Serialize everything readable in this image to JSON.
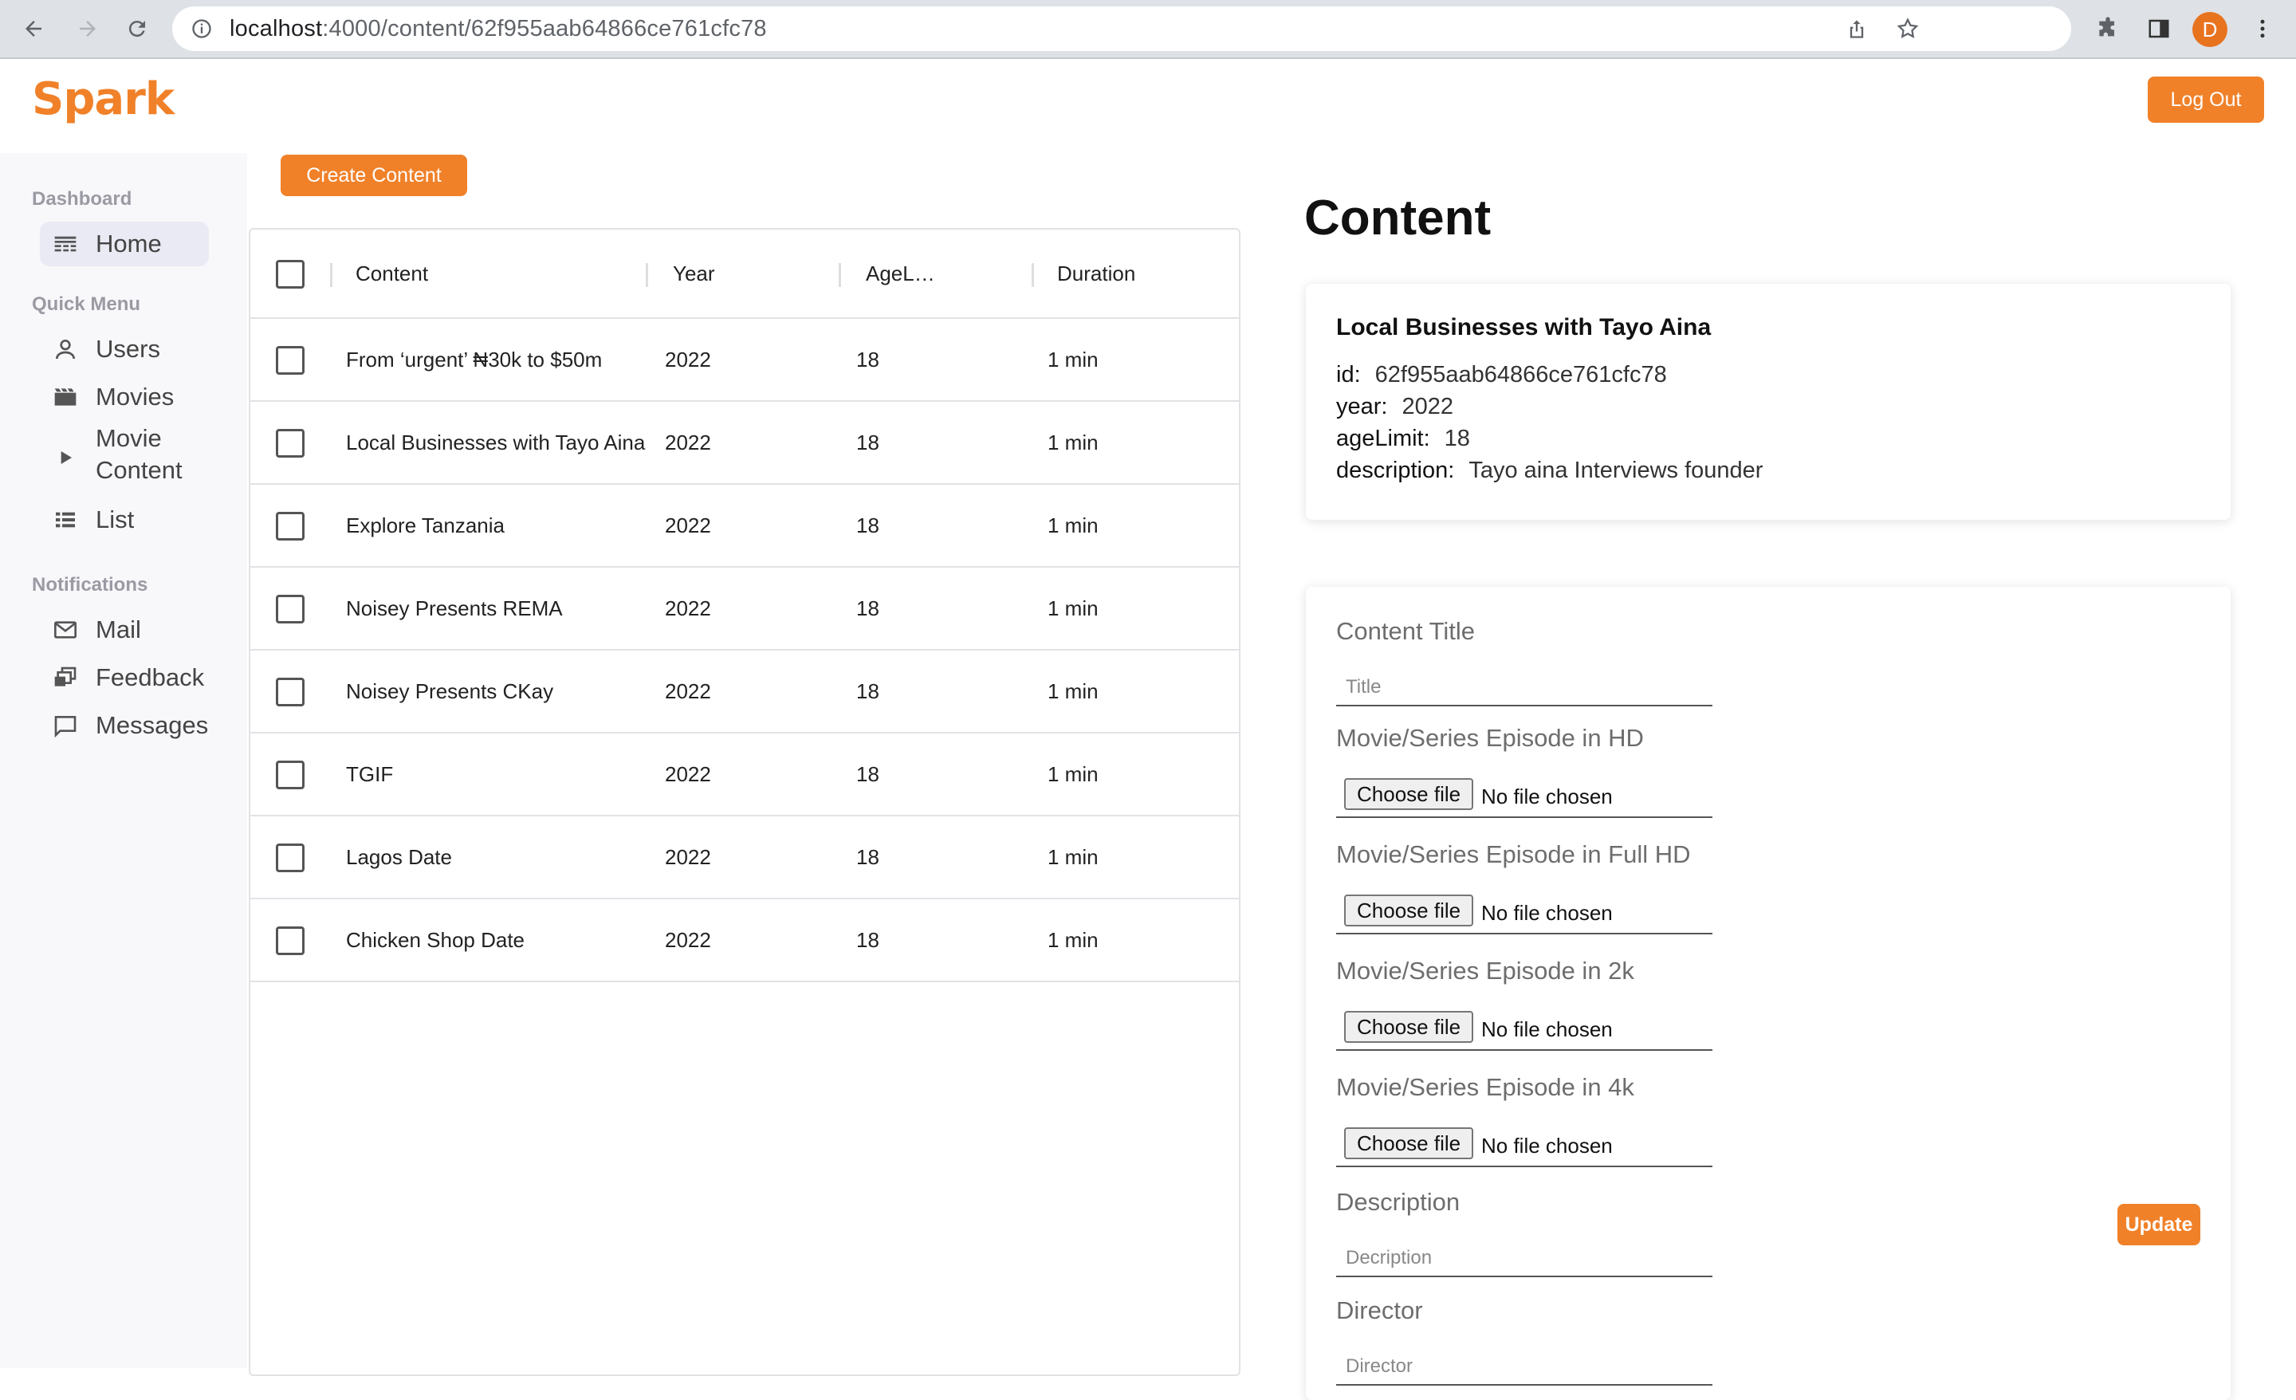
{
  "browser": {
    "url_host": "localhost",
    "url_path": ":4000/content/62f955aab64866ce761cfc78",
    "profile_initial": "D"
  },
  "app": {
    "brand": "Spark",
    "logout_label": "Log Out",
    "accent_color": "#f08129"
  },
  "sidebar": {
    "sections": [
      {
        "title": "Dashboard",
        "items": [
          {
            "label": "Home",
            "icon": "home-icon",
            "active": true
          }
        ]
      },
      {
        "title": "Quick Menu",
        "items": [
          {
            "label": "Users",
            "icon": "user-icon"
          },
          {
            "label": "Movies",
            "icon": "clapperboard-icon"
          },
          {
            "label": "Movie Content",
            "icon": "play-icon"
          },
          {
            "label": "List",
            "icon": "list-icon"
          }
        ]
      },
      {
        "title": "Notifications",
        "items": [
          {
            "label": "Mail",
            "icon": "mail-icon"
          },
          {
            "label": "Feedback",
            "icon": "feedback-icon"
          },
          {
            "label": "Messages",
            "icon": "message-icon"
          }
        ]
      }
    ]
  },
  "table": {
    "create_label": "Create Content",
    "columns": [
      "Content",
      "Year",
      "AgeL…",
      "Duration"
    ],
    "rows": [
      {
        "content": "From ‘urgent’ ₦30k to $50m",
        "year": "2022",
        "age": "18",
        "duration": "1 min"
      },
      {
        "content": "Local Businesses with Tayo Aina",
        "year": "2022",
        "age": "18",
        "duration": "1 min"
      },
      {
        "content": "Explore Tanzania",
        "year": "2022",
        "age": "18",
        "duration": "1 min"
      },
      {
        "content": "Noisey Presents REMA",
        "year": "2022",
        "age": "18",
        "duration": "1 min"
      },
      {
        "content": "Noisey Presents CKay",
        "year": "2022",
        "age": "18",
        "duration": "1 min"
      },
      {
        "content": "TGIF",
        "year": "2022",
        "age": "18",
        "duration": "1 min"
      },
      {
        "content": "Lagos Date",
        "year": "2022",
        "age": "18",
        "duration": "1 min"
      },
      {
        "content": "Chicken Shop Date",
        "year": "2022",
        "age": "18",
        "duration": "1 min"
      }
    ]
  },
  "detail": {
    "page_title": "Content",
    "name": "Local Businesses with Tayo Aina",
    "fields": [
      {
        "key": "id:",
        "value": "62f955aab64866ce761cfc78"
      },
      {
        "key": "year:",
        "value": "2022"
      },
      {
        "key": "ageLimit:",
        "value": "18"
      },
      {
        "key": "description:",
        "value": "Tayo aina Interviews founder"
      }
    ]
  },
  "form": {
    "title_label": "Content Title",
    "title_placeholder": "Title",
    "file_fields": [
      {
        "label": "Movie/Series Episode in HD"
      },
      {
        "label": "Movie/Series Episode in Full HD"
      },
      {
        "label": "Movie/Series Episode in 2k"
      },
      {
        "label": "Movie/Series Episode in 4k"
      }
    ],
    "choose_file_label": "Choose file",
    "no_file_text": "No file chosen",
    "description_label": "Description",
    "description_placeholder": "Decription",
    "director_label": "Director",
    "director_placeholder": "Director",
    "update_label": "Update"
  }
}
